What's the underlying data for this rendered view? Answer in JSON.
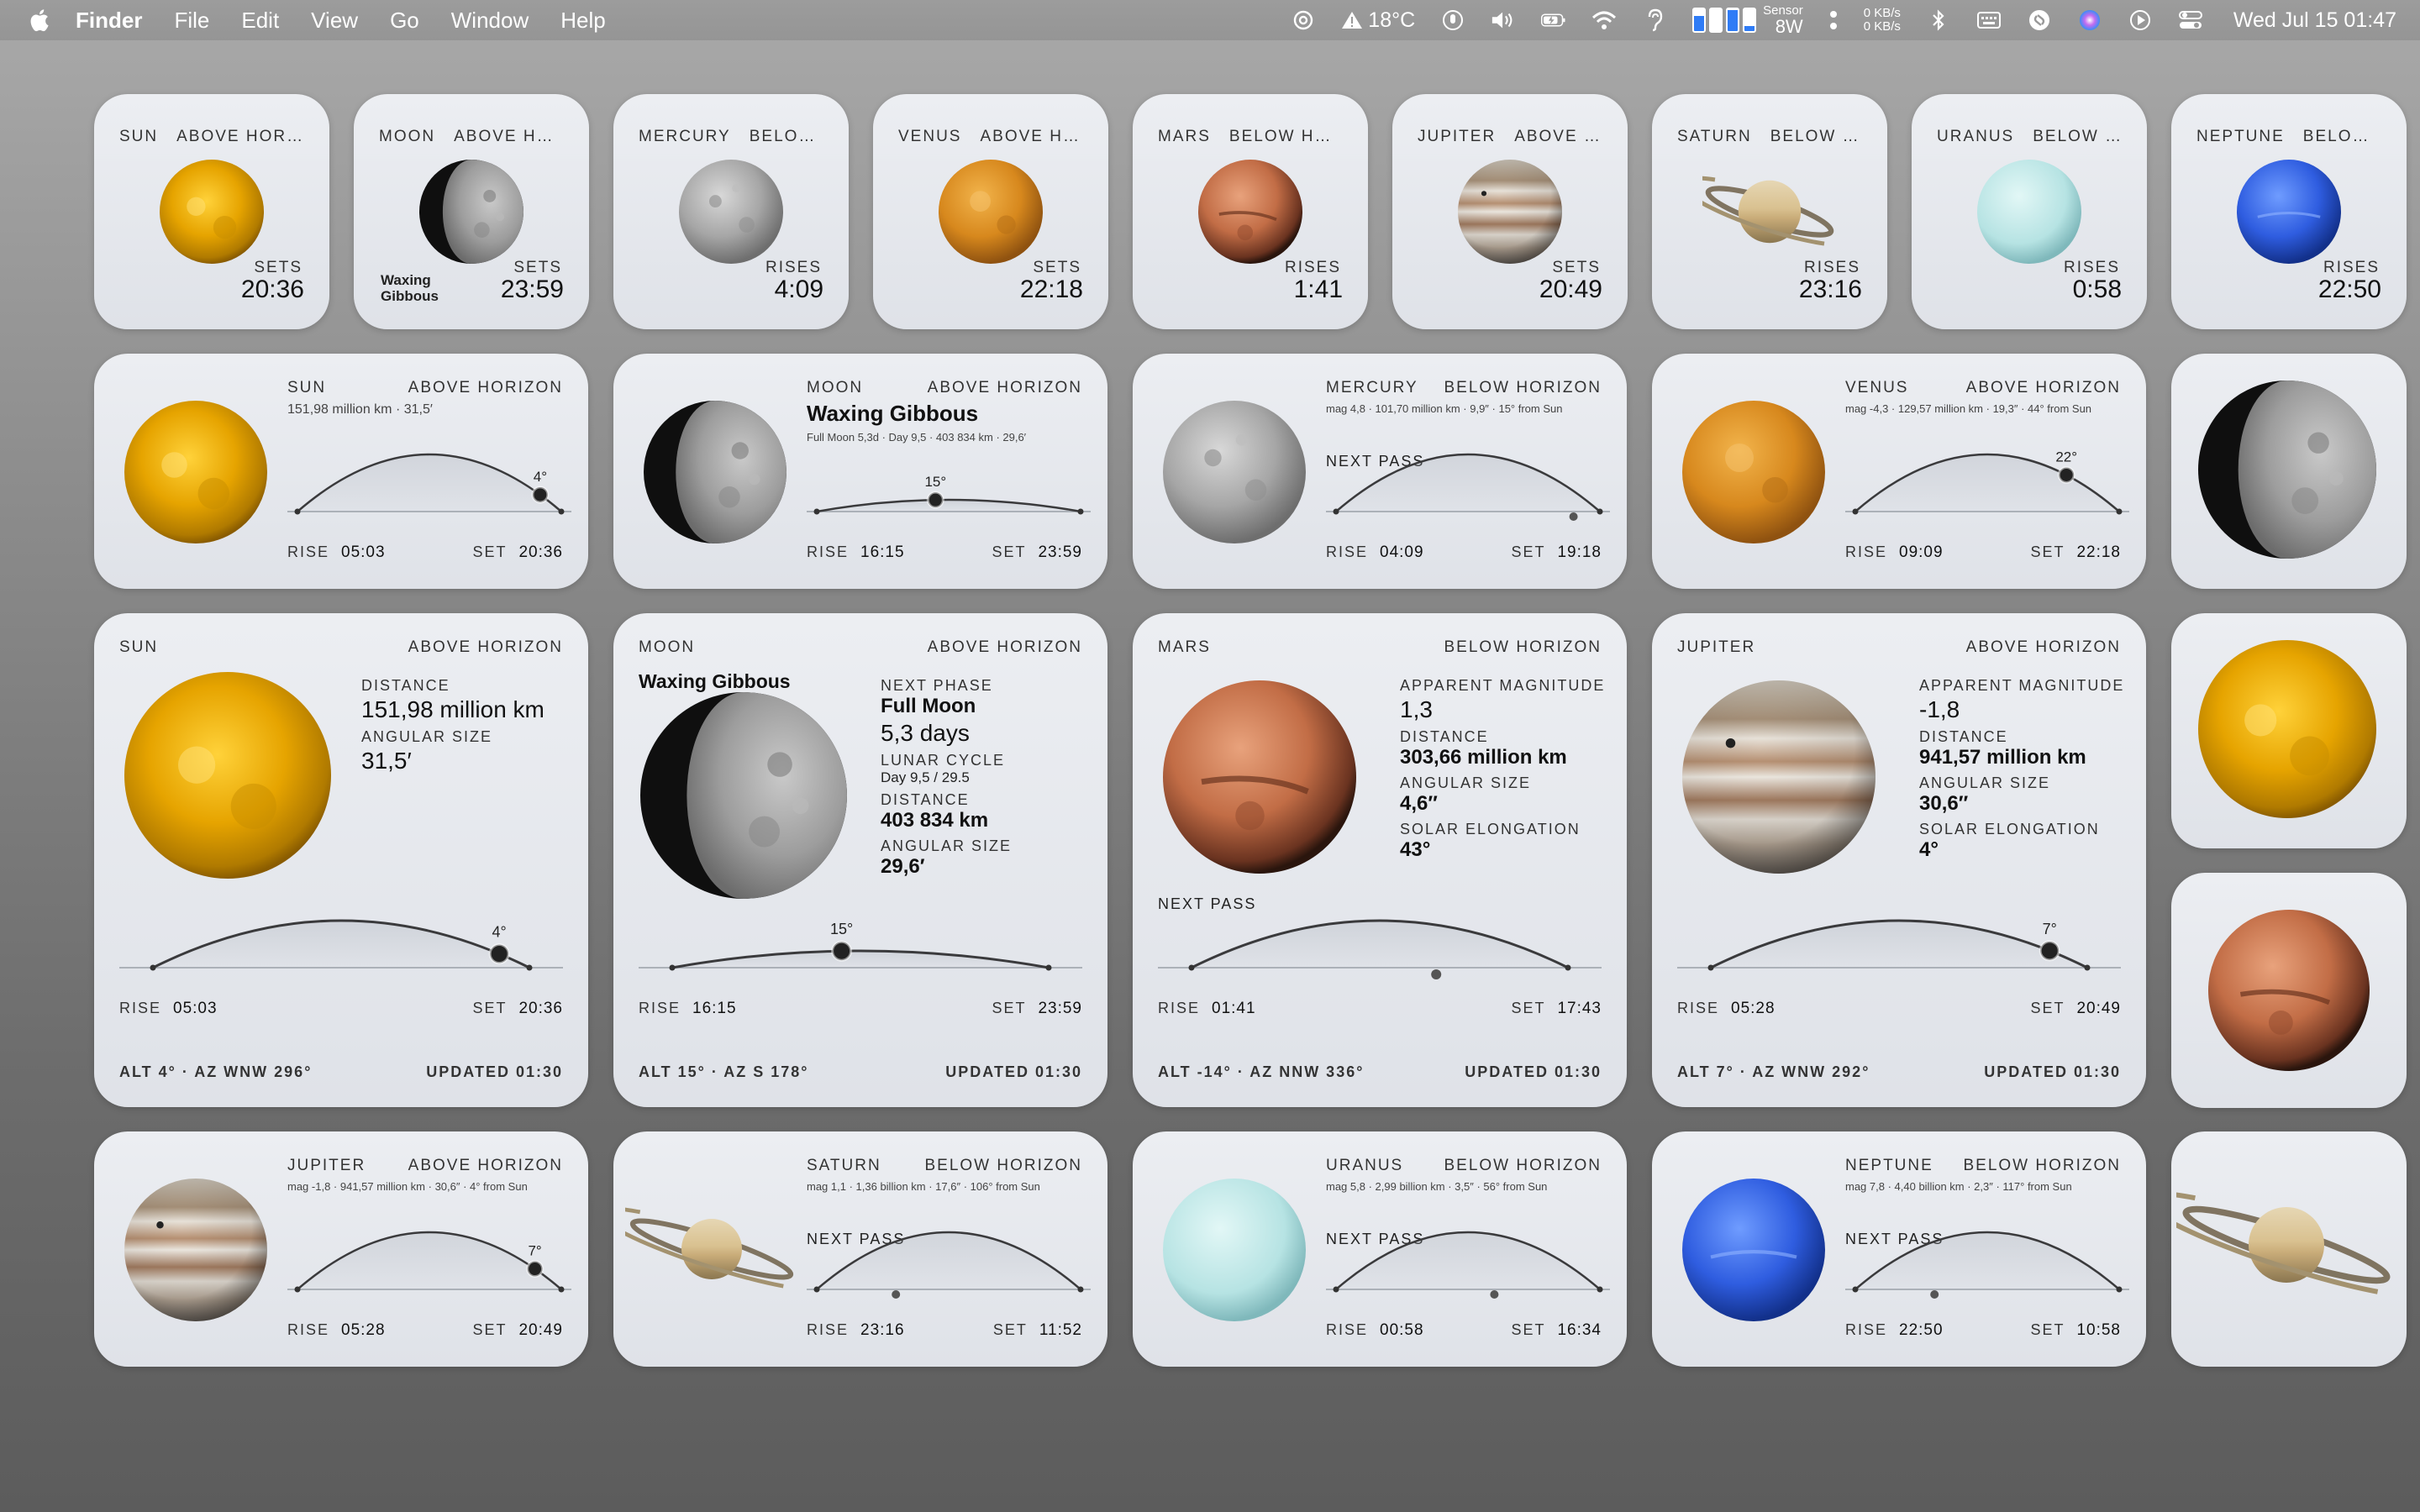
{
  "menubar": {
    "app": "Finder",
    "items": [
      "File",
      "Edit",
      "View",
      "Go",
      "Window",
      "Help"
    ],
    "weather": "18°C",
    "sensor_label": "Sensor",
    "sensor_value": "8W",
    "net_up": "0 KB/s",
    "net_down": "0 KB/s",
    "clock": "Wed Jul 15  01:47",
    "icons": [
      "apple-icon",
      "chatgpt-icon",
      "warning-icon",
      "mic-icon",
      "volume-icon",
      "battery-icon",
      "wifi-icon",
      "ear-icon",
      "memory-icon",
      "dots-icon",
      "bluetooth-icon",
      "keyboard-icon",
      "shazam-icon",
      "siri-icon",
      "play-icon",
      "control-center-icon"
    ]
  },
  "small": [
    {
      "name": "SUN",
      "status": "ABOVE HORIZON",
      "event": "SETS",
      "time": "20:36",
      "body": "sun"
    },
    {
      "name": "MOON",
      "status": "ABOVE HORIZ...",
      "event": "SETS",
      "time": "23:59",
      "body": "moon",
      "note": "Waxing Gibbous"
    },
    {
      "name": "MERCURY",
      "status": "BELOW H...",
      "event": "RISES",
      "time": "4:09",
      "body": "mercury"
    },
    {
      "name": "VENUS",
      "status": "ABOVE HORI...",
      "event": "SETS",
      "time": "22:18",
      "body": "venus"
    },
    {
      "name": "MARS",
      "status": "BELOW HORIZ...",
      "event": "RISES",
      "time": "1:41",
      "body": "mars"
    },
    {
      "name": "JUPITER",
      "status": "ABOVE HOR...",
      "event": "SETS",
      "time": "20:49",
      "body": "jupiter"
    },
    {
      "name": "SATURN",
      "status": "BELOW HOR...",
      "event": "RISES",
      "time": "23:16",
      "body": "saturn"
    },
    {
      "name": "URANUS",
      "status": "BELOW HO...",
      "event": "RISES",
      "time": "0:58",
      "body": "uranus"
    },
    {
      "name": "NEPTUNE",
      "status": "BELOW HO...",
      "event": "RISES",
      "time": "22:50",
      "body": "neptune"
    }
  ],
  "medium": [
    {
      "name": "SUN",
      "status": "ABOVE HORIZON",
      "sub": "151,98 million km · 31,5′",
      "rise": "05:03",
      "set": "20:36",
      "alt_label": "4°",
      "marker": 0.92,
      "above": true,
      "body": "sun"
    },
    {
      "name": "MOON",
      "status": "ABOVE HORIZON",
      "title": "Waxing Gibbous",
      "sub": "Full Moon 5,3d · Day 9,5 · 403 834 km · 29,6′",
      "rise": "16:15",
      "set": "23:59",
      "alt_label": "15°",
      "marker": 0.45,
      "above": true,
      "flat": true,
      "body": "moon"
    },
    {
      "name": "MERCURY",
      "status": "BELOW HORIZON",
      "sub": "mag 4,8 · 101,70 million km · 9,9″ · 15° from Sun",
      "next": "NEXT PASS",
      "rise": "04:09",
      "set": "19:18",
      "marker": 0.9,
      "above": false,
      "body": "mercury"
    },
    {
      "name": "VENUS",
      "status": "ABOVE HORIZON",
      "sub": "mag -4,3 · 129,57 million km · 19,3″ · 44° from Sun",
      "rise": "09:09",
      "set": "22:18",
      "alt_label": "22°",
      "marker": 0.8,
      "above": true,
      "body": "venus"
    },
    {
      "name": "JUPITER",
      "status": "ABOVE HORIZON",
      "sub": "mag -1,8 · 941,57 million km · 30,6″ · 4° from Sun",
      "rise": "05:28",
      "set": "20:49",
      "alt_label": "7°",
      "marker": 0.9,
      "above": true,
      "body": "jupiter"
    },
    {
      "name": "SATURN",
      "status": "BELOW HORIZON",
      "sub": "mag 1,1 · 1,36 billion km · 17,6″ · 106° from Sun",
      "next": "NEXT PASS",
      "rise": "23:16",
      "set": "11:52",
      "marker": 0.3,
      "above": false,
      "body": "saturn"
    },
    {
      "name": "URANUS",
      "status": "BELOW HORIZON",
      "sub": "mag 5,8 · 2,99 billion km · 3,5″ · 56° from Sun",
      "next": "NEXT PASS",
      "rise": "00:58",
      "set": "16:34",
      "marker": 0.6,
      "above": false,
      "body": "uranus"
    },
    {
      "name": "NEPTUNE",
      "status": "BELOW HORIZON",
      "sub": "mag 7,8 · 4,40 billion km · 2,3″ · 117° from Sun",
      "next": "NEXT PASS",
      "rise": "22:50",
      "set": "10:58",
      "marker": 0.3,
      "above": false,
      "body": "neptune"
    }
  ],
  "large": [
    {
      "name": "SUN",
      "status": "ABOVE HORIZON",
      "body": "sun",
      "stats": [
        {
          "label": "DISTANCE",
          "value": "151,98 million km",
          "style": "big"
        },
        {
          "label": "ANGULAR SIZE",
          "value": "31,5′",
          "style": "big"
        }
      ],
      "rise": "05:03",
      "set": "20:36",
      "alt_label": "4°",
      "marker": 0.92,
      "above": true,
      "alt": "ALT 4° · AZ WNW 296°",
      "updated": "UPDATED 01:30"
    },
    {
      "name": "MOON",
      "status": "ABOVE HORIZON",
      "body": "moon",
      "title": "Waxing Gibbous",
      "stats": [
        {
          "label": "NEXT PHASE",
          "value": "Full Moon",
          "style": "bold"
        },
        {
          "label": "",
          "value": "5,3 days",
          "style": "big"
        },
        {
          "label": "LUNAR CYCLE",
          "value": "Day 9,5 / 29.5",
          "style": "small"
        },
        {
          "label": "DISTANCE",
          "value": "403 834 km",
          "style": "bold"
        },
        {
          "label": "ANGULAR SIZE",
          "value": "29,6′",
          "style": "bold"
        }
      ],
      "rise": "16:15",
      "set": "23:59",
      "alt_label": "15°",
      "marker": 0.45,
      "above": true,
      "flat": true,
      "alt": "ALT 15° · AZ S 178°",
      "updated": "UPDATED 01:30"
    },
    {
      "name": "MARS",
      "status": "BELOW HORIZON",
      "body": "mars",
      "stats": [
        {
          "label": "APPARENT MAGNITUDE",
          "value": "1,3",
          "style": "big"
        },
        {
          "label": "DISTANCE",
          "value": "303,66 million km",
          "style": "bold"
        },
        {
          "label": "ANGULAR SIZE",
          "value": "4,6″",
          "style": "bold"
        },
        {
          "label": "SOLAR ELONGATION",
          "value": "43°",
          "style": "bold"
        }
      ],
      "next": "NEXT PASS",
      "rise": "01:41",
      "set": "17:43",
      "marker": 0.65,
      "above": false,
      "alt": "ALT -14° · AZ NNW 336°",
      "updated": "UPDATED 01:30"
    },
    {
      "name": "JUPITER",
      "status": "ABOVE HORIZON",
      "body": "jupiter",
      "stats": [
        {
          "label": "APPARENT MAGNITUDE",
          "value": "-1,8",
          "style": "big"
        },
        {
          "label": "DISTANCE",
          "value": "941,57 million km",
          "style": "bold"
        },
        {
          "label": "ANGULAR SIZE",
          "value": "30,6″",
          "style": "bold"
        },
        {
          "label": "SOLAR ELONGATION",
          "value": "4°",
          "style": "bold"
        }
      ],
      "rise": "05:28",
      "set": "20:49",
      "alt_label": "7°",
      "marker": 0.9,
      "above": true,
      "alt": "ALT 7° · AZ WNW 292°",
      "updated": "UPDATED 01:30"
    }
  ],
  "orb_only": [
    "moon",
    "sun",
    "mars",
    "saturn"
  ]
}
